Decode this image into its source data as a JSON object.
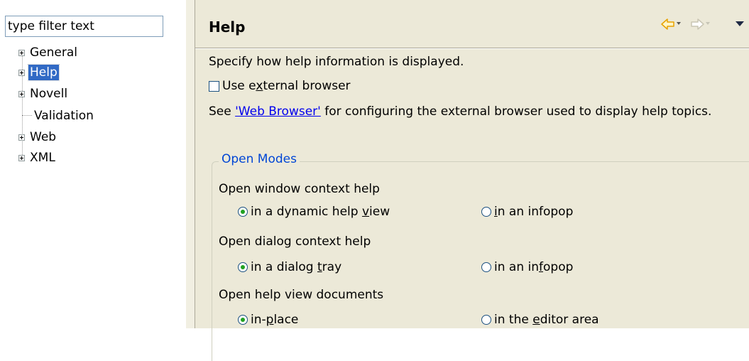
{
  "filter": {
    "placeholder": "type filter text"
  },
  "tree": {
    "items": [
      {
        "label": "General",
        "expandable": true,
        "selected": false
      },
      {
        "label": "Help",
        "expandable": true,
        "selected": true
      },
      {
        "label": "Novell",
        "expandable": true,
        "selected": false
      },
      {
        "label": "Validation",
        "expandable": false,
        "selected": false
      },
      {
        "label": "Web",
        "expandable": true,
        "selected": false
      },
      {
        "label": "XML",
        "expandable": true,
        "selected": false
      }
    ]
  },
  "page": {
    "title": "Help",
    "description": "Specify how help information is displayed.",
    "external_browser": {
      "label_pre": "Use e",
      "label_mnemonic": "x",
      "label_post": "ternal browser",
      "checked": false
    },
    "see_prefix": "See ",
    "see_link": "'Web Browser'",
    "see_suffix": " for configuring the external browser used to display help topics.",
    "open_modes": {
      "legend": "Open Modes",
      "window": {
        "label": "Open window context help",
        "opt1_pre": "in a dynamic help ",
        "opt1_mn": "v",
        "opt1_post": "iew",
        "opt2_pre": "",
        "opt2_mn": "i",
        "opt2_post": "n an infopop",
        "selected": "opt1"
      },
      "dialog": {
        "label": "Open dialog context help",
        "opt1_pre": "in a dialog ",
        "opt1_mn": "t",
        "opt1_post": "ray",
        "opt2_pre": "in an in",
        "opt2_mn": "f",
        "opt2_post": "opop",
        "selected": "opt1"
      },
      "docs": {
        "label": "Open help view documents",
        "opt1_pre": "in-",
        "opt1_mn": "p",
        "opt1_post": "lace",
        "opt2_pre": "in the ",
        "opt2_mn": "e",
        "opt2_post": "ditor area",
        "selected": "opt1"
      }
    }
  },
  "toolbar": {
    "back_icon": "back-arrow-icon",
    "forward_icon": "forward-arrow-icon",
    "view_menu_icon": "view-menu-icon"
  },
  "colors": {
    "page_bg": "#ece9d8",
    "selection": "#316ac5",
    "link": "#0000ee",
    "group_legend": "#0046d5",
    "radio_dot": "#21a121",
    "back_arrow": "#e8a200"
  }
}
